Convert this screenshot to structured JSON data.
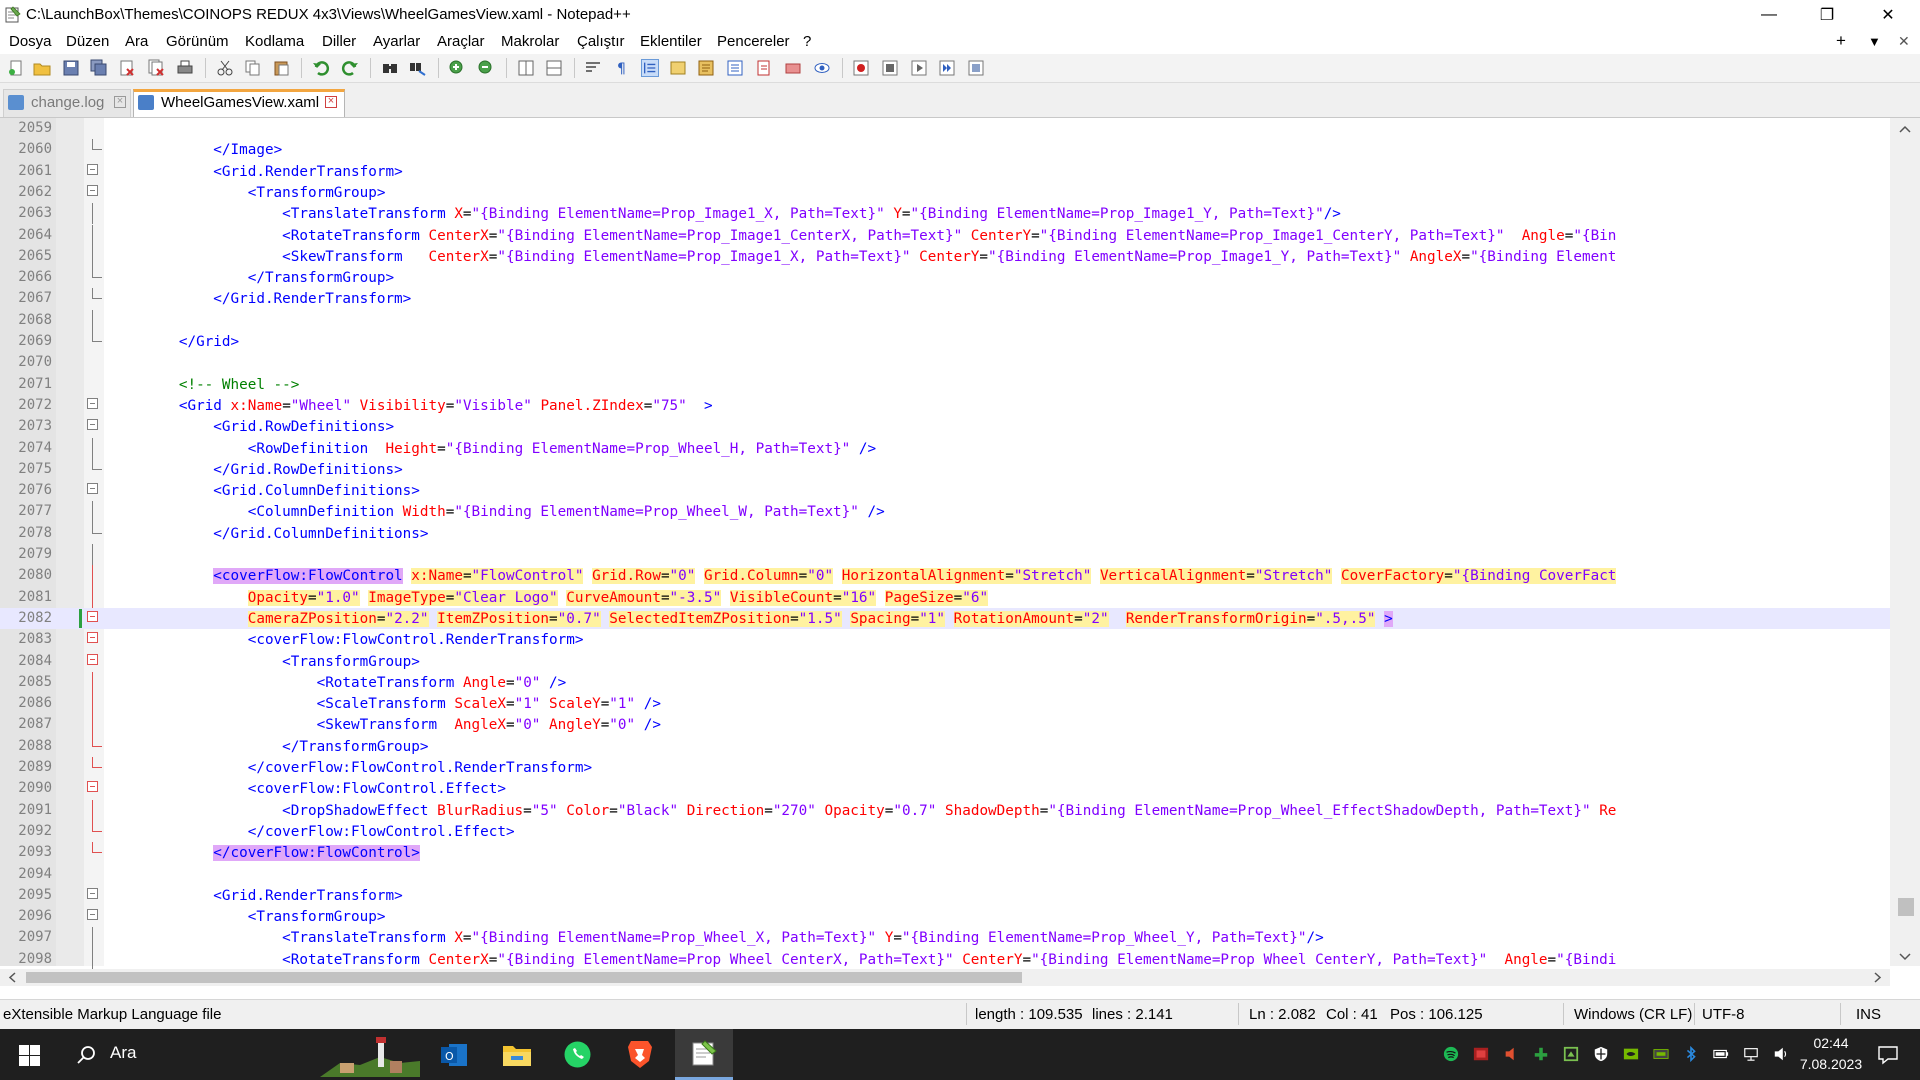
{
  "window": {
    "title": "C:\\LaunchBox\\Themes\\COINOPS REDUX 4x3\\Views\\WheelGamesView.xaml - Notepad++",
    "minimize_glyph": "—",
    "restore_glyph": "❐",
    "close_glyph": "✕"
  },
  "menu": {
    "items": [
      "Dosya",
      "Düzen",
      "Ara",
      "Görünüm",
      "Kodlama",
      "Diller",
      "Ayarlar",
      "Araçlar",
      "Makrolar",
      "Çalıştır",
      "Eklentiler",
      "Pencereler",
      "?"
    ],
    "right_plus": "+",
    "right_down": "▼",
    "right_close": "✕"
  },
  "tabs": [
    {
      "label": "change.log",
      "active": false
    },
    {
      "label": "WheelGamesView.xaml",
      "active": true
    }
  ],
  "editor": {
    "current_line": "2082",
    "lines": [
      {
        "n": "2059",
        "text": ""
      },
      {
        "n": "2060",
        "text": "            </Image>"
      },
      {
        "n": "2061",
        "text": "            <Grid.RenderTransform>"
      },
      {
        "n": "2062",
        "text": "                <TransformGroup>"
      },
      {
        "n": "2063",
        "text": "                    <TranslateTransform X=\"{Binding ElementName=Prop_Image1_X, Path=Text}\" Y=\"{Binding ElementName=Prop_Image1_Y, Path=Text}\"/>"
      },
      {
        "n": "2064",
        "text": "                    <RotateTransform CenterX=\"{Binding ElementName=Prop_Image1_CenterX, Path=Text}\" CenterY=\"{Binding ElementName=Prop_Image1_CenterY, Path=Text}\"  Angle=\"{Bin"
      },
      {
        "n": "2065",
        "text": "                    <SkewTransform   CenterX=\"{Binding ElementName=Prop_Image1_X, Path=Text}\" CenterY=\"{Binding ElementName=Prop_Image1_Y, Path=Text}\" AngleX=\"{Binding Element"
      },
      {
        "n": "2066",
        "text": "                </TransformGroup>"
      },
      {
        "n": "2067",
        "text": "            </Grid.RenderTransform>"
      },
      {
        "n": "2068",
        "text": ""
      },
      {
        "n": "2069",
        "text": "        </Grid>"
      },
      {
        "n": "2070",
        "text": ""
      },
      {
        "n": "2071",
        "text": "        <!-- Wheel -->"
      },
      {
        "n": "2072",
        "text": "        <Grid x:Name=\"Wheel\" Visibility=\"Visible\" Panel.ZIndex=\"75\"  >"
      },
      {
        "n": "2073",
        "text": "            <Grid.RowDefinitions>"
      },
      {
        "n": "2074",
        "text": "                <RowDefinition  Height=\"{Binding ElementName=Prop_Wheel_H, Path=Text}\" />"
      },
      {
        "n": "2075",
        "text": "            </Grid.RowDefinitions>"
      },
      {
        "n": "2076",
        "text": "            <Grid.ColumnDefinitions>"
      },
      {
        "n": "2077",
        "text": "                <ColumnDefinition Width=\"{Binding ElementName=Prop_Wheel_W, Path=Text}\" />"
      },
      {
        "n": "2078",
        "text": "            </Grid.ColumnDefinitions>"
      },
      {
        "n": "2079",
        "text": ""
      },
      {
        "n": "2080",
        "text": "            <coverFlow:FlowControl x:Name=\"FlowControl\" Grid.Row=\"0\" Grid.Column=\"0\" HorizontalAlignment=\"Stretch\" VerticalAlignment=\"Stretch\" CoverFactory=\"{Binding CoverFact"
      },
      {
        "n": "2081",
        "text": "                Opacity=\"1.0\" ImageType=\"Clear Logo\" CurveAmount=\"-3.5\" VisibleCount=\"16\" PageSize=\"6\""
      },
      {
        "n": "2082",
        "text": "                CameraZPosition=\"2.2\" ItemZPosition=\"0.7\" SelectedItemZPosition=\"1.5\" Spacing=\"1\" RotationAmount=\"2\"  RenderTransformOrigin=\".5,.5\" >"
      },
      {
        "n": "2083",
        "text": "                <coverFlow:FlowControl.RenderTransform>"
      },
      {
        "n": "2084",
        "text": "                    <TransformGroup>"
      },
      {
        "n": "2085",
        "text": "                        <RotateTransform Angle=\"0\" />"
      },
      {
        "n": "2086",
        "text": "                        <ScaleTransform ScaleX=\"1\" ScaleY=\"1\" />"
      },
      {
        "n": "2087",
        "text": "                        <SkewTransform  AngleX=\"0\" AngleY=\"0\" />"
      },
      {
        "n": "2088",
        "text": "                    </TransformGroup>"
      },
      {
        "n": "2089",
        "text": "                </coverFlow:FlowControl.RenderTransform>"
      },
      {
        "n": "2090",
        "text": "                <coverFlow:FlowControl.Effect>"
      },
      {
        "n": "2091",
        "text": "                    <DropShadowEffect BlurRadius=\"5\" Color=\"Black\" Direction=\"270\" Opacity=\"0.7\" ShadowDepth=\"{Binding ElementName=Prop_Wheel_EffectShadowDepth, Path=Text}\" Re"
      },
      {
        "n": "2092",
        "text": "                </coverFlow:FlowControl.Effect>"
      },
      {
        "n": "2093",
        "text": "            </coverFlow:FlowControl>"
      },
      {
        "n": "2094",
        "text": ""
      },
      {
        "n": "2095",
        "text": "            <Grid.RenderTransform>"
      },
      {
        "n": "2096",
        "text": "                <TransformGroup>"
      },
      {
        "n": "2097",
        "text": "                    <TranslateTransform X=\"{Binding ElementName=Prop_Wheel_X, Path=Text}\" Y=\"{Binding ElementName=Prop_Wheel_Y, Path=Text}\"/>"
      },
      {
        "n": "2098",
        "text": "                    <RotateTransform CenterX=\"{Binding ElementName=Prop Wheel CenterX, Path=Text}\" CenterY=\"{Binding ElementName=Prop Wheel CenterY, Path=Text}\"  Angle=\"{Bindi"
      }
    ]
  },
  "status": {
    "file_type": "eXtensible Markup Language file",
    "length": "length : 109.535",
    "lines": "lines : 2.141",
    "ln": "Ln : 2.082",
    "col": "Col : 41",
    "pos": "Pos : 106.125",
    "eol": "Windows (CR LF)",
    "encoding": "UTF-8",
    "mode": "INS"
  },
  "taskbar": {
    "search_label": "Ara",
    "time": "02:44",
    "date": "7.08.2023"
  },
  "colors": {
    "tag": "#0000ff",
    "attr": "#ff0000",
    "value": "#8000ff",
    "comment": "#008000",
    "tag_highlight": "#e0a8f8",
    "attr_highlight": "#fff2a0",
    "current_line": "#e8e8ff",
    "tab_accent": "#f3a640"
  }
}
